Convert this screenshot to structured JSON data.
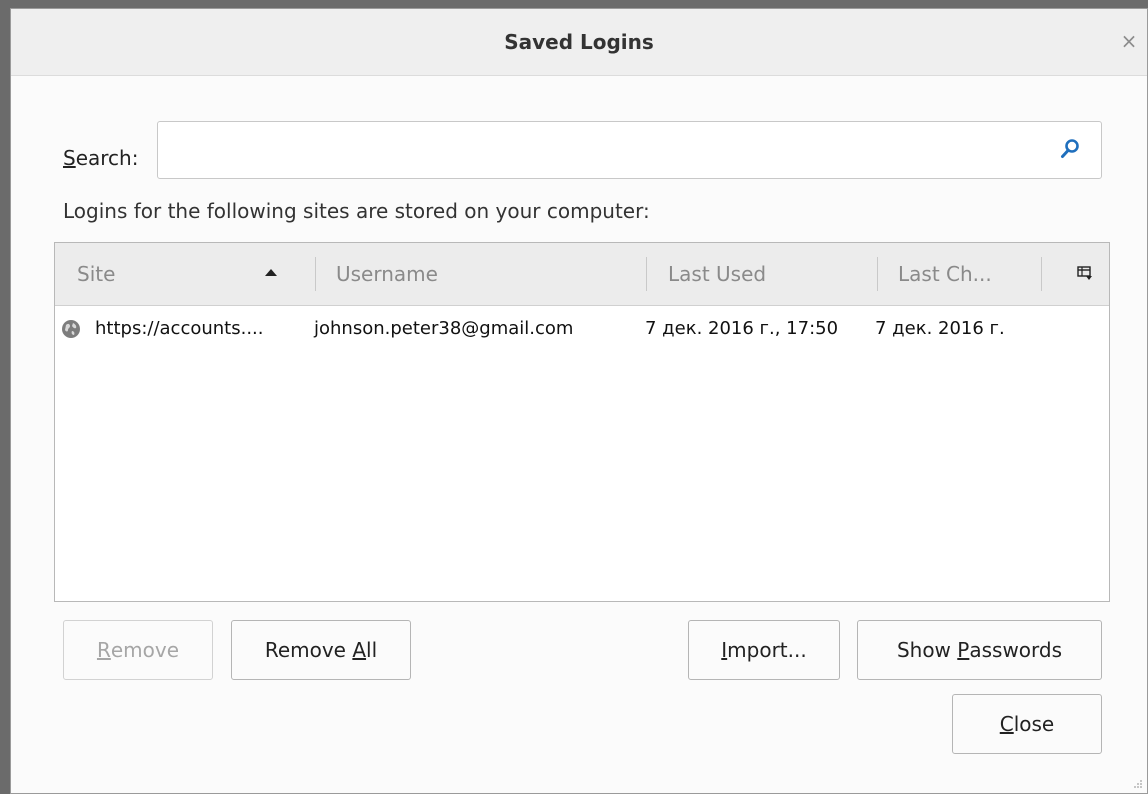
{
  "window": {
    "title": "Saved Logins",
    "close_glyph": "×"
  },
  "search": {
    "label_accesskey": "S",
    "label_rest": "earch:",
    "value": "",
    "placeholder": "",
    "icon": "search-icon"
  },
  "description": "Logins for the following sites are stored on your computer:",
  "table": {
    "columns": [
      {
        "label": "Site",
        "sorted": "ascending"
      },
      {
        "label": "Username"
      },
      {
        "label": "Last Used"
      },
      {
        "label": "Last Ch..."
      }
    ],
    "column_picker_icon": "column-picker-icon",
    "rows": [
      {
        "icon": "globe-icon",
        "site": "https://accounts....",
        "username": "johnson.peter38@gmail.com",
        "last_used": "7 дек. 2016 г., 17:50",
        "last_changed": "7 дек. 2016 г."
      }
    ]
  },
  "buttons": {
    "remove": {
      "accesskey": "R",
      "rest": "emove",
      "enabled": false
    },
    "remove_all": {
      "before": "Remove ",
      "accesskey": "A",
      "rest": "ll",
      "enabled": true
    },
    "import": {
      "accesskey": "I",
      "rest": "mport...",
      "enabled": true
    },
    "show_passwords": {
      "before": "Show ",
      "accesskey": "P",
      "rest": "asswords",
      "enabled": true
    },
    "close": {
      "accesskey": "C",
      "rest": "lose",
      "enabled": true
    }
  },
  "colors": {
    "search_icon": "#1f6fbd",
    "disabled_text": "#a6a6a6",
    "header_text": "#8a8a8a"
  }
}
